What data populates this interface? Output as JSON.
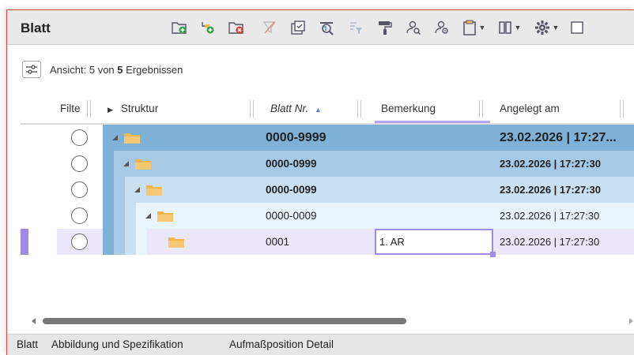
{
  "window": {
    "title": "Blatt"
  },
  "toolbar": {
    "icons": [
      "folder-add-icon",
      "folder-add-child-icon",
      "folder-delete-icon",
      "filter-clear-icon",
      "checklist-icon",
      "search-filter-icon",
      "column-filter-icon",
      "paint-roller-icon",
      "user-search-icon",
      "user-zoom-icon",
      "clipboard-dropdown-icon",
      "columns-dropdown-icon",
      "settings-dropdown-icon",
      "checkbox-icon"
    ]
  },
  "view": {
    "prefix": "Ansicht: 5 von ",
    "count": "5",
    "suffix": " Ergebnissen"
  },
  "columns": {
    "filter": "Filte",
    "structure": "Struktur",
    "blatt_nr": "Blatt Nr.",
    "remark": "Bemerkung",
    "created": "Angelegt am"
  },
  "rows": [
    {
      "level": 0,
      "blatt_nr": "0000-9999",
      "remark": "",
      "created": "23.02.2026 | 17:27...",
      "style": "level0"
    },
    {
      "level": 1,
      "blatt_nr": "0000-0999",
      "remark": "",
      "created": "23.02.2026 | 17:27:30",
      "style": "level1"
    },
    {
      "level": 2,
      "blatt_nr": "0000-0099",
      "remark": "",
      "created": "23.02.2026 | 17:27:30",
      "style": "level2"
    },
    {
      "level": 3,
      "blatt_nr": "0000-0009",
      "remark": "",
      "created": "23.02.2026 | 17:27:30",
      "style": "level3"
    },
    {
      "level": 4,
      "blatt_nr": "0001",
      "remark": "1. AR",
      "created": "23.02.2026 | 17:27:30",
      "style": "selected"
    }
  ],
  "tabs": [
    "Blatt",
    "Abbildung und Spezifikation",
    "Aufmaßposition Detail"
  ],
  "colors": {
    "level0": "#7fb0d6",
    "level1": "#a6c9e5",
    "level2": "#c9e0f2",
    "level3": "#e8f3fb",
    "selected": "#ece6fb",
    "accent": "#a08ce6",
    "folder": "#f2b64e"
  }
}
